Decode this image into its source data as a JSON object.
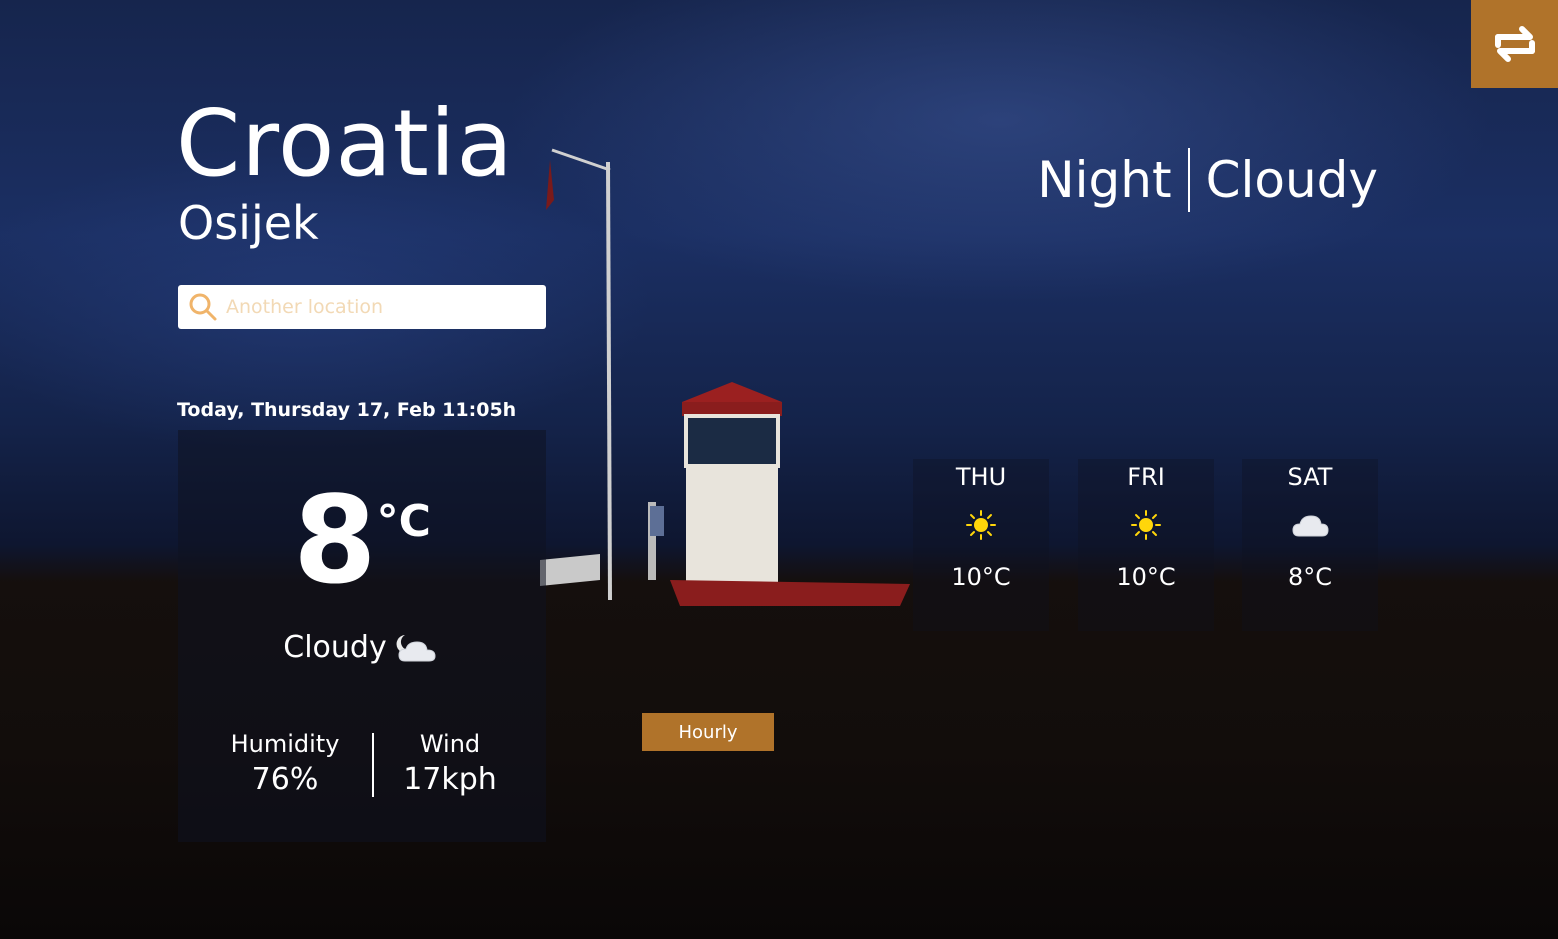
{
  "location": {
    "country": "Croatia",
    "city": "Osijek"
  },
  "search": {
    "placeholder": "Another location",
    "icon": "search-icon"
  },
  "toggle": {
    "icon": "swap-arrows-icon"
  },
  "current": {
    "date_label": "Today, Thursday 17, Feb 11:05h",
    "temperature": "8",
    "unit": "°C",
    "condition": "Cloudy",
    "condition_icon": "night-cloud-icon",
    "humidity_label": "Humidity",
    "humidity_value": "76%",
    "wind_label": "Wind",
    "wind_value": "17kph"
  },
  "headline": {
    "time_of_day": "Night",
    "condition": "Cloudy"
  },
  "forecast": [
    {
      "day": "THU",
      "icon": "sun-icon",
      "temp": "10°C"
    },
    {
      "day": "FRI",
      "icon": "sun-icon",
      "temp": "10°C"
    },
    {
      "day": "SAT",
      "icon": "cloud-icon",
      "temp": "8°C"
    }
  ],
  "hourly_button": {
    "label": "Hourly"
  },
  "colors": {
    "accent": "#b0732a",
    "sun": "#ffd60a"
  }
}
